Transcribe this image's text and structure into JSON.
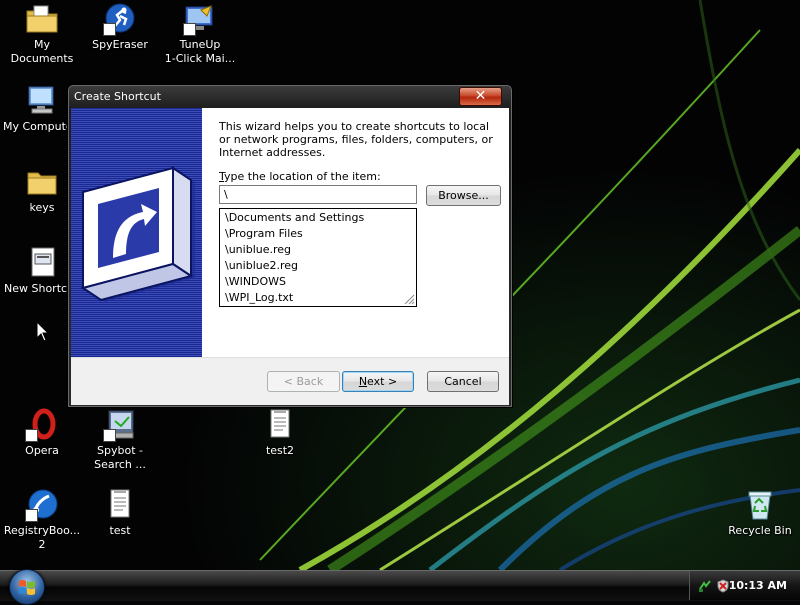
{
  "desktop": {
    "icons": [
      {
        "label": "My\nDocuments"
      },
      {
        "label": "SpyEraser"
      },
      {
        "label": "TuneUp\n1-Click Mai..."
      },
      {
        "label": "My Computer"
      },
      {
        "label": "keys"
      },
      {
        "label": "New Shortcut"
      },
      {
        "label": "Opera"
      },
      {
        "label": "Spybot -\nSearch ..."
      },
      {
        "label": "test2"
      },
      {
        "label": "RegistryBoo...\n2"
      },
      {
        "label": "test"
      },
      {
        "label": "Recycle Bin"
      }
    ]
  },
  "dialog": {
    "title": "Create Shortcut",
    "close_label": "✕",
    "intro": "This wizard helps you to create shortcuts to local or network programs, files, folders, computers, or Internet addresses.",
    "location_label": "Type the location of the item:",
    "location_value": "\\",
    "browse_label": "Browse...",
    "suggestions": [
      "\\Documents and Settings",
      "\\Program Files",
      "\\uniblue.reg",
      "\\uniblue2.reg",
      "\\WINDOWS",
      "\\WPI_Log.txt"
    ],
    "back_label": "< Back",
    "next_label": "Next >",
    "cancel_label": "Cancel"
  },
  "taskbar": {
    "clock": "10:13 AM"
  },
  "colors": {
    "wizard_art": "#2f3fa6",
    "close_button": "#c74a2b"
  }
}
